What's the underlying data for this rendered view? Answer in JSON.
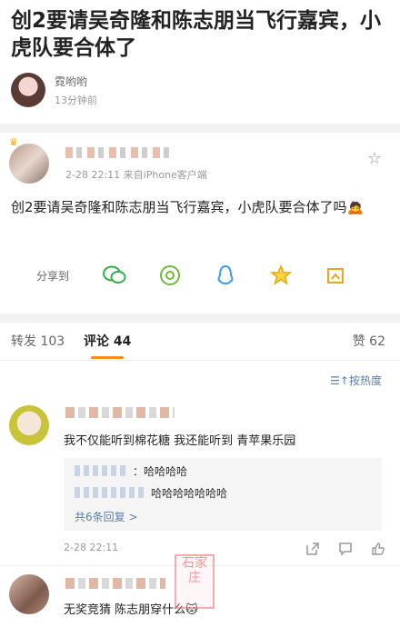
{
  "article": {
    "title": "创2要请吴奇隆和陈志朋当飞行嘉宾，小虎队要合体了",
    "author": {
      "name": "霓哟哟",
      "time": "13分钟前"
    }
  },
  "post": {
    "meta": "2-28 22:11  来自iPhone客户端",
    "text": "创2要请吴奇隆和陈志朋当飞行嘉宾，小虎队要合体了吗🙇",
    "share_label": "分享到",
    "icons": [
      "star-icon",
      "wechat-icon",
      "moments-icon",
      "qq-icon",
      "qzone-icon",
      "screenshot-icon"
    ]
  },
  "tabs": {
    "repost": "转发 103",
    "comments": "评论 44",
    "likes": "赞 62"
  },
  "sort": {
    "label": "☰↑按热度"
  },
  "comments": [
    {
      "text": "我不仅能听到棉花糖 我还能听到 青苹果乐园",
      "replies": [
        {
          "text": "：哈哈哈哈"
        },
        {
          "text": "哈哈哈哈哈哈哈"
        }
      ],
      "more": "共6条回复 >",
      "time": "2-28 22:11"
    },
    {
      "text": "无奖竞猜 陈志朋穿什么🐱"
    }
  ],
  "watermark": {
    "text": "石家庄"
  },
  "colors": {
    "accent": "#f78c1e",
    "link": "#597eb0"
  }
}
